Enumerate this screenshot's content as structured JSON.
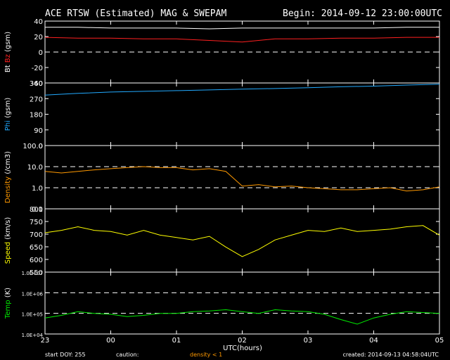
{
  "header": {
    "title": "ACE RTSW (Estimated) MAG & SWEPAM",
    "begin": "Begin: 2014-09-12 23:00:00UTC"
  },
  "footer": {
    "start_doy": "start DOY: 255",
    "caution": "caution:",
    "density_note": "density < 1",
    "created": "created: 2014-09-13 04:58:04UTC"
  },
  "colors": {
    "background": "#000000",
    "axes": "#ffffff",
    "bt": "#ffffff",
    "bz": "#ff2020",
    "phi": "#22aaff",
    "density": "#ff9900",
    "speed": "#ffff00",
    "temp": "#00ee00",
    "caution": "#ffffff",
    "density_caution": "#ff9900"
  },
  "chart_data": [
    {
      "type": "line",
      "panel": "mag",
      "ylabel_parts": [
        "Bt",
        "Bz",
        "(gsm)"
      ],
      "ylim": [
        -40,
        40
      ],
      "yticks": [
        "40",
        "20",
        "0",
        "-20",
        "-40"
      ],
      "dashed": [
        0
      ],
      "x_range": [
        0,
        6
      ],
      "series": [
        {
          "name": "Bt",
          "x": [
            0,
            0.5,
            1,
            1.5,
            2,
            2.5,
            3,
            3.5,
            4,
            4.5,
            5,
            5.5,
            6
          ],
          "values": [
            32,
            32,
            31,
            31,
            31,
            30,
            31,
            31,
            31,
            31,
            31,
            32,
            32
          ]
        },
        {
          "name": "Bz",
          "x": [
            0,
            0.5,
            1,
            1.5,
            2,
            2.5,
            3,
            3.5,
            4,
            4.5,
            5,
            5.5,
            6
          ],
          "values": [
            19,
            18,
            18,
            17,
            17,
            15,
            13,
            17,
            17,
            18,
            18,
            19,
            19
          ]
        }
      ]
    },
    {
      "type": "line",
      "panel": "phi",
      "ylabel_parts": [
        "Phi",
        "(gsm)"
      ],
      "ylim": [
        0,
        360
      ],
      "yticks": [
        "360",
        "270",
        "180",
        "90",
        "0"
      ],
      "x_range": [
        0,
        6
      ],
      "series": [
        {
          "name": "Phi",
          "x": [
            0,
            0.5,
            1,
            1.5,
            2,
            2.5,
            3,
            3.5,
            4,
            4.5,
            5,
            5.5,
            6
          ],
          "values": [
            290,
            300,
            308,
            312,
            316,
            320,
            325,
            328,
            333,
            338,
            342,
            348,
            353
          ]
        }
      ]
    },
    {
      "type": "line",
      "panel": "density",
      "ylabel_parts": [
        "Density",
        "(/cm3)"
      ],
      "log": true,
      "ylim": [
        0.1,
        100
      ],
      "yticks": [
        "100.0",
        "10.0",
        "1.0",
        "0.1"
      ],
      "dashed": [
        10,
        1
      ],
      "x_range": [
        0,
        6
      ],
      "series": [
        {
          "name": "Density",
          "x": [
            0,
            0.25,
            0.5,
            0.75,
            1,
            1.25,
            1.5,
            1.75,
            2,
            2.25,
            2.5,
            2.75,
            3,
            3.25,
            3.5,
            3.75,
            4,
            4.25,
            4.5,
            4.75,
            5,
            5.25,
            5.5,
            5.75,
            6
          ],
          "values": [
            6,
            5,
            6,
            7,
            8,
            9,
            10,
            9,
            9,
            7,
            8,
            6,
            1.2,
            1.4,
            1.1,
            1.2,
            1.0,
            0.9,
            0.8,
            0.8,
            0.9,
            1.0,
            0.7,
            0.8,
            1.1
          ]
        }
      ]
    },
    {
      "type": "line",
      "panel": "speed",
      "ylabel_parts": [
        "Speed",
        "(km/s)"
      ],
      "ylim": [
        545,
        810
      ],
      "yticks": [
        "800",
        "750",
        "700",
        "650",
        "600",
        "550"
      ],
      "x_range": [
        0,
        6
      ],
      "series": [
        {
          "name": "Speed",
          "x": [
            0,
            0.25,
            0.5,
            0.75,
            1,
            1.25,
            1.5,
            1.75,
            2,
            2.25,
            2.5,
            2.75,
            3,
            3.25,
            3.5,
            3.75,
            4,
            4.25,
            4.5,
            4.75,
            5,
            5.25,
            5.5,
            5.75,
            6
          ],
          "values": [
            710,
            720,
            735,
            720,
            715,
            700,
            720,
            700,
            690,
            680,
            695,
            650,
            610,
            640,
            680,
            700,
            720,
            715,
            730,
            715,
            720,
            725,
            735,
            740,
            700
          ]
        }
      ]
    },
    {
      "type": "line",
      "panel": "temp",
      "ylabel_parts": [
        "Temp",
        "(K)"
      ],
      "log": true,
      "ylim": [
        10000,
        10000000
      ],
      "yticks": [
        "1.0E+07",
        "1.0E+06",
        "1.0E+05",
        "1.0E+04"
      ],
      "dashed": [
        1000000,
        100000
      ],
      "x_range": [
        0,
        6
      ],
      "series": [
        {
          "name": "Temp",
          "x": [
            0,
            0.25,
            0.5,
            0.75,
            1,
            1.25,
            1.5,
            1.75,
            2,
            2.25,
            2.5,
            2.75,
            3,
            3.25,
            3.5,
            3.75,
            4,
            4.25,
            4.5,
            4.75,
            5,
            5.25,
            5.5,
            5.75,
            6
          ],
          "values": [
            60000,
            80000,
            120000,
            100000,
            90000,
            70000,
            80000,
            100000,
            100000,
            120000,
            130000,
            150000,
            120000,
            100000,
            150000,
            130000,
            120000,
            90000,
            50000,
            30000,
            60000,
            90000,
            120000,
            110000,
            100000
          ]
        }
      ]
    }
  ],
  "x_axis": {
    "ticks": [
      "23",
      "00",
      "01",
      "02",
      "03",
      "04",
      "05"
    ],
    "xlabel": "UTC(hours)"
  }
}
